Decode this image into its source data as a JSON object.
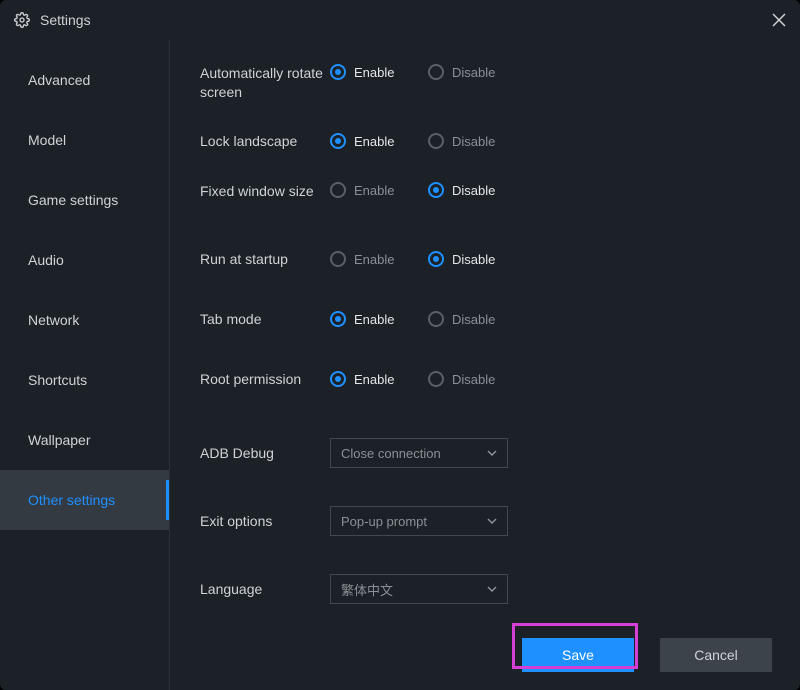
{
  "titlebar": {
    "title": "Settings"
  },
  "sidebar": {
    "items": [
      {
        "label": "Advanced"
      },
      {
        "label": "Model"
      },
      {
        "label": "Game settings"
      },
      {
        "label": "Audio"
      },
      {
        "label": "Network"
      },
      {
        "label": "Shortcuts"
      },
      {
        "label": "Wallpaper"
      },
      {
        "label": "Other settings"
      }
    ]
  },
  "settings": {
    "rotate": {
      "label": "Automatically rotate screen",
      "enable": "Enable",
      "disable": "Disable",
      "value": "enable"
    },
    "lock": {
      "label": "Lock landscape",
      "enable": "Enable",
      "disable": "Disable",
      "value": "enable"
    },
    "fixedsize": {
      "label": "Fixed window size",
      "enable": "Enable",
      "disable": "Disable",
      "value": "disable"
    },
    "startup": {
      "label": "Run at startup",
      "enable": "Enable",
      "disable": "Disable",
      "value": "disable"
    },
    "tabmode": {
      "label": "Tab mode",
      "enable": "Enable",
      "disable": "Disable",
      "value": "enable"
    },
    "root": {
      "label": "Root permission",
      "enable": "Enable",
      "disable": "Disable",
      "value": "enable"
    },
    "adb": {
      "label": "ADB Debug",
      "selected": "Close connection"
    },
    "exit": {
      "label": "Exit options",
      "selected": "Pop-up prompt"
    },
    "language": {
      "label": "Language",
      "selected": "繁体中文"
    }
  },
  "footer": {
    "save": "Save",
    "cancel": "Cancel"
  }
}
